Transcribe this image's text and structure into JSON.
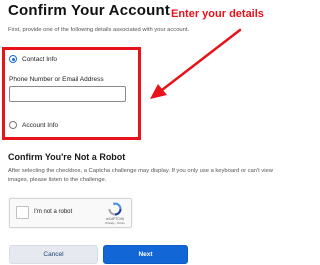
{
  "page": {
    "title": "Confirm Your Account",
    "subtitle": "First, provide one of the following details associated with your account."
  },
  "annotation": {
    "label": "Enter your details",
    "color": "#e8121b"
  },
  "options": {
    "contact_info_label": "Contact Info",
    "contact_info_selected": true,
    "field_label": "Phone Number or Email Address",
    "field_value": "",
    "account_info_label": "Account Info",
    "account_info_selected": false
  },
  "robot": {
    "title": "Confirm You're Not a Robot",
    "description": "After selecting the checkbox, a Captcha challenge may display. If you only use a keyboard or can't view images, please listen to the challenge.",
    "checkbox_label": "I'm not a robot",
    "brand": "reCAPTCHA",
    "links": "Privacy - Terms"
  },
  "buttons": {
    "cancel": "Cancel",
    "next": "Next"
  },
  "icons": {
    "captcha_logo": "recaptcha-logo-icon",
    "arrow": "red-arrow-icon"
  },
  "colors": {
    "accent": "#1366d6",
    "highlight": "#e8121b"
  }
}
